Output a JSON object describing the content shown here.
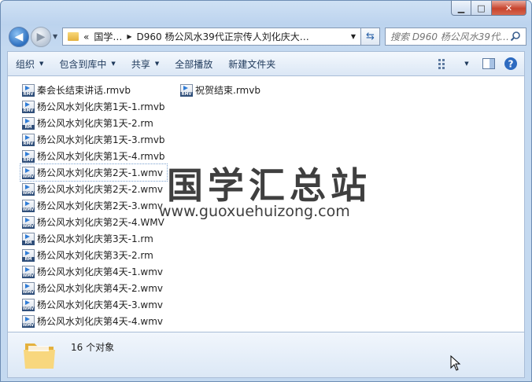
{
  "window": {
    "caption": {
      "minimize": "▁",
      "maximize": "□",
      "close": "✕"
    }
  },
  "navigation": {
    "address_path": [
      "«",
      "国学…",
      "D960 杨公风水39代正宗传人刘化庆大…"
    ],
    "search_placeholder": "搜索 D960 杨公风水39代…"
  },
  "toolbar": {
    "organize": "组织",
    "include_in_library": "包含到库中",
    "share": "共享",
    "play_all": "全部播放",
    "new_folder": "新建文件夹"
  },
  "files": {
    "column1": [
      {
        "name": "秦会长结束讲话.rmvb",
        "type": "RMV"
      },
      {
        "name": "杨公风水刘化庆第1天-1.rmvb",
        "type": "RMV"
      },
      {
        "name": "杨公风水刘化庆第1天-2.rm",
        "type": "RM"
      },
      {
        "name": "杨公风水刘化庆第1天-3.rmvb",
        "type": "RMV"
      },
      {
        "name": "杨公风水刘化庆第1天-4.rmvb",
        "type": "RMV"
      },
      {
        "name": "杨公风水刘化庆第2天-1.wmv",
        "type": "WMV"
      },
      {
        "name": "杨公风水刘化庆第2天-2.wmv",
        "type": "WMV"
      },
      {
        "name": "杨公风水刘化庆第2天-3.wmv",
        "type": "WMV"
      },
      {
        "name": "杨公风水刘化庆第2天-4.WMV",
        "type": "WMV"
      },
      {
        "name": "杨公风水刘化庆第3天-1.rm",
        "type": "RM"
      },
      {
        "name": "杨公风水刘化庆第3天-2.rm",
        "type": "RM"
      },
      {
        "name": "杨公风水刘化庆第4天-1.wmv",
        "type": "WMV"
      },
      {
        "name": "杨公风水刘化庆第4天-2.wmv",
        "type": "WMV"
      },
      {
        "name": "杨公风水刘化庆第4天-3.wmv",
        "type": "WMV"
      },
      {
        "name": "杨公风水刘化庆第4天-4.wmv",
        "type": "WMV"
      }
    ],
    "column2": [
      {
        "name": "祝贺结束.rmvb",
        "type": "RMV"
      }
    ]
  },
  "watermark": {
    "title": "国学汇总站",
    "url": "www.guoxuehuizong.com"
  },
  "status": {
    "item_count": "16 个对象"
  },
  "colors": {
    "accent": "#2f7cd6",
    "file_tag": "#304f7a"
  }
}
